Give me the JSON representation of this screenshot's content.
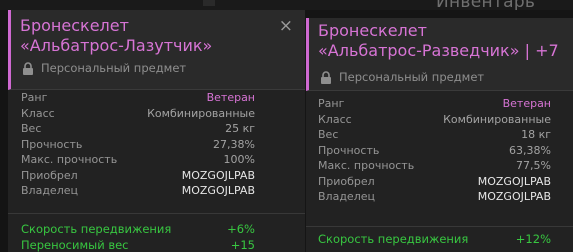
{
  "background": {
    "title": "Инвентарь"
  },
  "left_card": {
    "name_line1": "Бронескелет",
    "name_line2": "«Альбатрос-Лазутчик»",
    "close_glyph": "×",
    "personal_label": "Персональный предмет",
    "stats": [
      {
        "label": "Ранг",
        "value": "Ветеран"
      },
      {
        "label": "Класс",
        "value": "Комбинированные"
      },
      {
        "label": "Вес",
        "value": "25 кг"
      },
      {
        "label": "Прочность",
        "value": "27,38%"
      },
      {
        "label": "Макс. прочность",
        "value": "100%"
      },
      {
        "label": "Приобрел",
        "value": "MOZGOJLPAB"
      },
      {
        "label": "Владелец",
        "value": "MOZGOJLPAB"
      }
    ],
    "bonuses": [
      {
        "label": "Скорость передвижения",
        "value": "+6%"
      },
      {
        "label": "Переносимый вес",
        "value": "+15"
      }
    ]
  },
  "right_card": {
    "name_line1": "Бронескелет",
    "name_line2": "«Альбатрос-Разведчик» | +7",
    "personal_label": "Персональный предмет",
    "stats": [
      {
        "label": "Ранг",
        "value": "Ветеран"
      },
      {
        "label": "Класс",
        "value": "Комбинированные"
      },
      {
        "label": "Вес",
        "value": "18 кг"
      },
      {
        "label": "Прочность",
        "value": "63,38%"
      },
      {
        "label": "Макс. прочность",
        "value": "77,5%"
      },
      {
        "label": "Приобрел",
        "value": "MOZGOJLPAB"
      },
      {
        "label": "Владелец",
        "value": "MOZGOJLPAB"
      }
    ],
    "bonuses": [
      {
        "label": "Скорость передвижения",
        "value": "+12%"
      }
    ]
  },
  "colors": {
    "rank_accent": "#d774d5",
    "bonus_green": "#38c741",
    "panel_bg": "#222222"
  }
}
